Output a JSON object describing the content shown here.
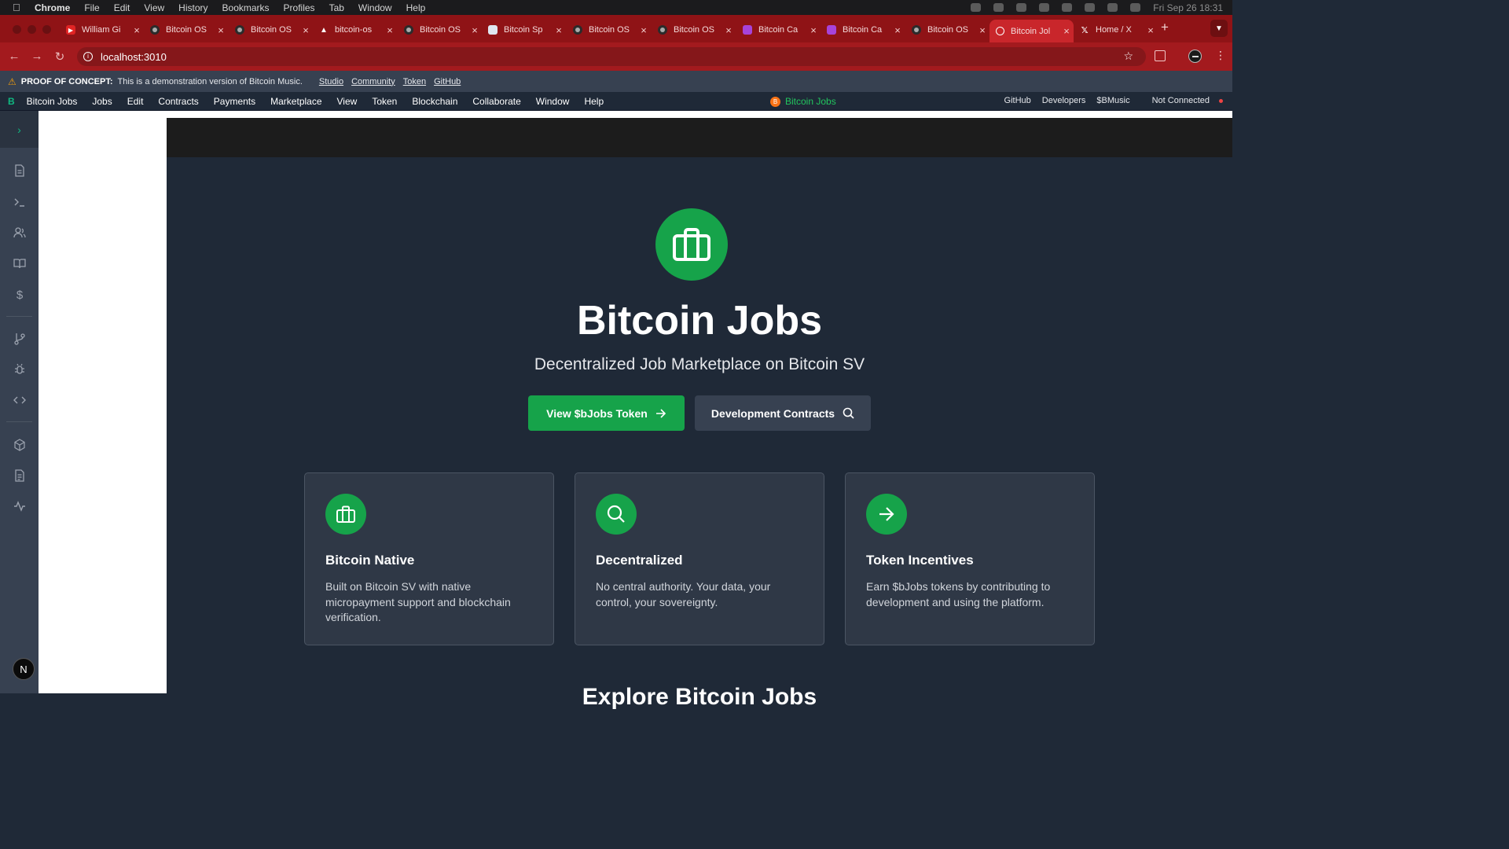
{
  "mac_menu": {
    "app": "Chrome",
    "items": [
      "File",
      "Edit",
      "View",
      "History",
      "Bookmarks",
      "Profiles",
      "Tab",
      "Window",
      "Help"
    ],
    "clock": "Fri Sep 26  18:31"
  },
  "tabs": [
    {
      "title": "William Gi",
      "favicon": "youtube-icon"
    },
    {
      "title": "Bitcoin OS",
      "favicon": "github-icon"
    },
    {
      "title": "Bitcoin OS",
      "favicon": "github-icon"
    },
    {
      "title": "bitcoin-os",
      "favicon": "vercel-icon"
    },
    {
      "title": "Bitcoin OS",
      "favicon": "github-icon"
    },
    {
      "title": "Bitcoin Sp",
      "favicon": "doc-icon"
    },
    {
      "title": "Bitcoin OS",
      "favicon": "github-icon"
    },
    {
      "title": "Bitcoin OS",
      "favicon": "github-icon"
    },
    {
      "title": "Bitcoin Ca",
      "favicon": "calendar-icon"
    },
    {
      "title": "Bitcoin Ca",
      "favicon": "calendar-icon"
    },
    {
      "title": "Bitcoin OS",
      "favicon": "github-icon"
    },
    {
      "title": "Bitcoin Jol",
      "favicon": "globe-icon",
      "active": true
    },
    {
      "title": "Home / X",
      "favicon": "x-icon"
    }
  ],
  "address_bar": {
    "url": "localhost:3010"
  },
  "poc_banner": {
    "label": "PROOF OF CONCEPT:",
    "message": "This is a demonstration version of Bitcoin Music.",
    "links": [
      "Studio",
      "Community",
      "Token",
      "GitHub"
    ]
  },
  "app_menu": {
    "logo": "B",
    "items": [
      "Bitcoin Jobs",
      "Jobs",
      "Edit",
      "Contracts",
      "Payments",
      "Marketplace",
      "View",
      "Token",
      "Blockchain",
      "Collaborate",
      "Window",
      "Help"
    ],
    "center_label": "Bitcoin Jobs",
    "center_coin": "B",
    "right_links": [
      "GitHub",
      "Developers",
      "$BMusic"
    ],
    "connection_status": "Not Connected",
    "status_color": "#ef4444"
  },
  "sidebar": {
    "icons": [
      "document-icon",
      "terminal-icon",
      "users-icon",
      "book-icon",
      "dollar-icon",
      "git-branch-icon",
      "bug-icon",
      "code-icon",
      "package-icon",
      "file-icon",
      "activity-icon"
    ],
    "badge": "N"
  },
  "hero": {
    "title": "Bitcoin Jobs",
    "subtitle": "Decentralized Job Marketplace on Bitcoin SV",
    "primary_button": "View $bJobs Token",
    "secondary_button": "Development Contracts",
    "accent": "#16a34a"
  },
  "features": [
    {
      "title": "Bitcoin Native",
      "description": "Built on Bitcoin SV with native micropayment support and blockchain verification.",
      "icon": "briefcase-icon"
    },
    {
      "title": "Decentralized",
      "description": "No central authority. Your data, your control, your sovereignty.",
      "icon": "search-icon"
    },
    {
      "title": "Token Incentives",
      "description": "Earn $bJobs tokens by contributing to development and using the platform.",
      "icon": "arrow-right-icon"
    }
  ],
  "section_title": "Explore Bitcoin Jobs"
}
